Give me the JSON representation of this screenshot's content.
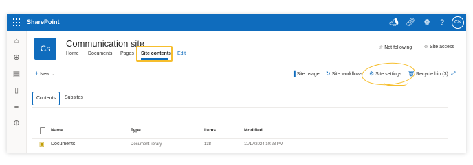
{
  "suite": {
    "brand": "SharePoint",
    "avatar": "CN",
    "icons": [
      "megaphone-icon",
      "share-icon",
      "settings-icon",
      "help-icon"
    ]
  },
  "site": {
    "logo": "Cs",
    "title": "Communication site",
    "nav": [
      "Home",
      "Documents",
      "Pages",
      "Site contents"
    ],
    "edit": "Edit"
  },
  "header_actions": {
    "follow": "Not following",
    "access": "Site access"
  },
  "commandbar": {
    "new": "New",
    "usage": "Site usage",
    "workflows": "Site workflows",
    "settings": "Site settings",
    "recycle": "Recycle bin (3)"
  },
  "tabs": {
    "contents": "Contents",
    "subsites": "Subsites"
  },
  "table": {
    "headers": {
      "name": "Name",
      "type": "Type",
      "items": "Items",
      "modified": "Modified"
    },
    "rows": [
      {
        "name": "Documents",
        "type": "Document library",
        "items": "138",
        "modified": "11/17/2024 10:23 PM"
      }
    ]
  },
  "colors": {
    "brand": "#0f6cbd",
    "highlight": "#f6be2d"
  }
}
